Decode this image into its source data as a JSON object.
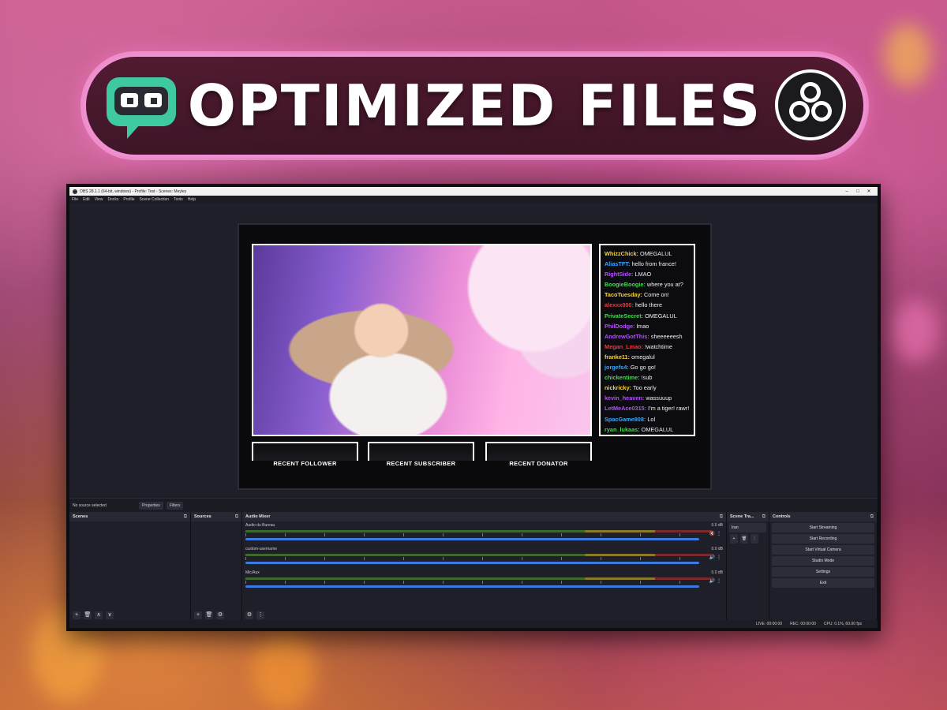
{
  "banner": {
    "title": "OPTIMIZED FILES",
    "left_logo": "streamlabs-logo",
    "right_logo": "obs-logo"
  },
  "window": {
    "title": "OBS 28.1.1 (64-bit, windows) - Profile: Test - Scenes: Meyley",
    "menu": [
      "File",
      "Edit",
      "View",
      "Docks",
      "Profile",
      "Scene Collection",
      "Tools",
      "Help"
    ]
  },
  "chat": [
    {
      "user": "WhizzChick:",
      "msg": "OMEGALUL",
      "color": "#f2d23c"
    },
    {
      "user": "AliasTFT:",
      "msg": "hello from france!",
      "color": "#36a7ff"
    },
    {
      "user": "RightSide:",
      "msg": "LMAO",
      "color": "#b44dff"
    },
    {
      "user": "BoogieBoogie:",
      "msg": "where you at?",
      "color": "#42d94a"
    },
    {
      "user": "TacoTuesday:",
      "msg": "Come on!",
      "color": "#f2d23c"
    },
    {
      "user": "alexxx000:",
      "msg": "hello there",
      "color": "#ff3030"
    },
    {
      "user": "PrivateSecret:",
      "msg": "OMEGALUL",
      "color": "#42d94a"
    },
    {
      "user": "PhilDodge:",
      "msg": "lmao",
      "color": "#b44dff"
    },
    {
      "user": "AndrewGotThis:",
      "msg": "sheeeeeesh",
      "color": "#b44dff"
    },
    {
      "user": "Megan_Lmao:",
      "msg": "!watchtime",
      "color": "#ff3030"
    },
    {
      "user": "franke11:",
      "msg": "omegalul",
      "color": "#f2d23c"
    },
    {
      "user": "jorgefs4:",
      "msg": "Go go go!",
      "color": "#36a7ff"
    },
    {
      "user": "chickentime:",
      "msg": "!sub",
      "color": "#42d94a"
    },
    {
      "user": "nickricky:",
      "msg": "Too early",
      "color": "#f2d23c"
    },
    {
      "user": "kevin_heaven:",
      "msg": "wassuuup",
      "color": "#b44dff"
    },
    {
      "user": "LetMeAce0315:",
      "msg": "I'm a tiger! rawr!",
      "color": "#b44dff"
    },
    {
      "user": "SpacGame808:",
      "msg": "Lol",
      "color": "#36a7ff"
    },
    {
      "user": "ryan_lukaas:",
      "msg": "OMEGALUL",
      "color": "#42d94a"
    }
  ],
  "recent": {
    "follower": "RECENT FOLLOWER",
    "subscriber": "RECENT SUBSCRIBER",
    "donator": "RECENT DONATOR"
  },
  "source_bar": {
    "no_source": "No source selected",
    "properties": "Properties",
    "filters": "Filters"
  },
  "docks": {
    "scenes": "Scenes",
    "sources": "Sources",
    "audio_mixer": "Audio Mixer",
    "scene_transitions": "Scene Tra...",
    "controls": "Controls"
  },
  "mixer": [
    {
      "name": "Audio du Bureau",
      "db": "0.0 dB"
    },
    {
      "name": "custom-username",
      "db": "0.0 dB"
    },
    {
      "name": "Mic/Aux",
      "db": "0.0 dB"
    }
  ],
  "transition": {
    "value": "Iran"
  },
  "controls": [
    "Start Streaming",
    "Start Recording",
    "Start Virtual Camera",
    "Studio Mode",
    "Settings",
    "Exit"
  ],
  "status": {
    "live": "LIVE: 00:00:00",
    "rec": "REC: 00:00:00",
    "cpu": "CPU: 0.1%, 60.00 fps"
  }
}
